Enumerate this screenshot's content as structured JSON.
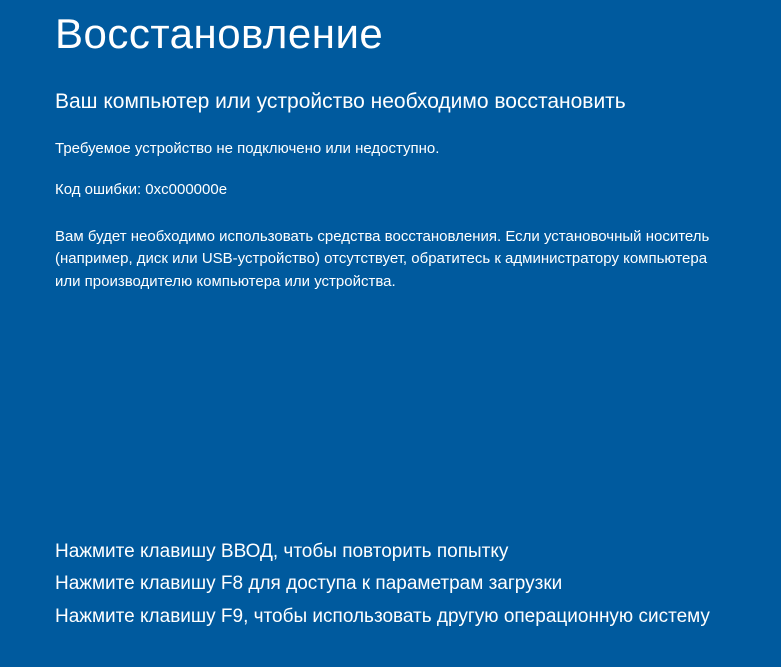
{
  "header": {
    "title": "Восстановление"
  },
  "content": {
    "subtitle": "Ваш компьютер или устройство необходимо восстановить",
    "message_1": "Требуемое устройство не подключено или недоступно.",
    "error_code": "Код ошибки: 0xc000000e",
    "message_2": "Вам будет необходимо использовать средства восстановления. Если установочный носитель (например, диск или USB-устройство) отсутствует, обратитесь к администратору компьютера или производителю компьютера или устройства."
  },
  "footer": {
    "instruction_1": "Нажмите клавишу ВВОД, чтобы повторить попытку",
    "instruction_2": "Нажмите клавишу F8 для доступа к параметрам загрузки",
    "instruction_3": "Нажмите клавишу F9, чтобы использовать другую операционную систему"
  }
}
